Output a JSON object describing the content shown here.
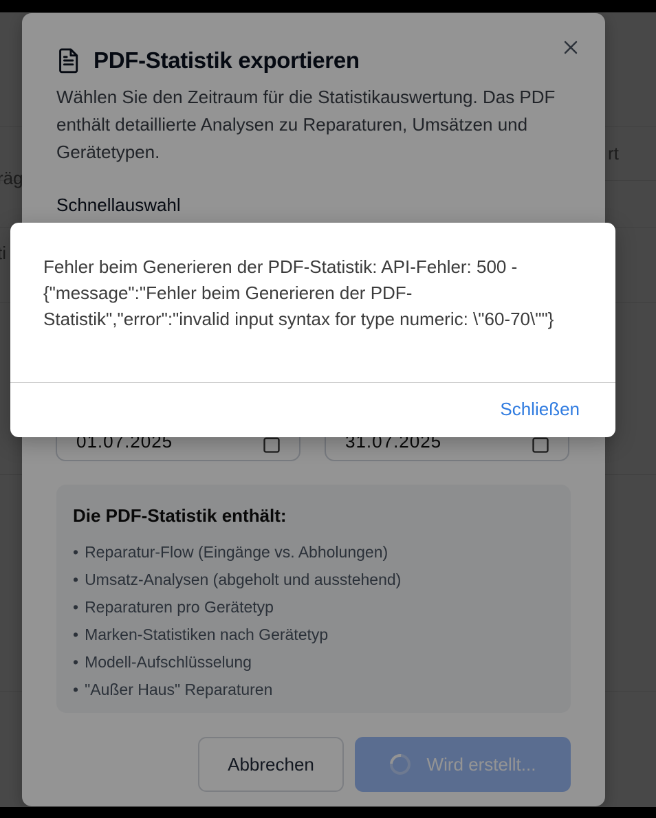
{
  "background": {
    "partial_texts": [
      "rt",
      "räg",
      "ti"
    ]
  },
  "export_dialog": {
    "title": "PDF-Statistik exportieren",
    "description": "Wählen Sie den Zeitraum für die Statistikauswertung. Das PDF enthält detaillierte Analysen zu Reparaturen, Umsätzen und Gerätetypen.",
    "quick_select_label": "Schnellauswahl",
    "start_date": "01.07.2025",
    "end_date": "31.07.2025",
    "info_title": "Die PDF-Statistik enthält:",
    "info_items": [
      "Reparatur-Flow (Eingänge vs. Abholungen)",
      "Umsatz-Analysen (abgeholt und ausstehend)",
      "Reparaturen pro Gerätetyp",
      "Marken-Statistiken nach Gerätetyp",
      "Modell-Aufschlüsselung",
      "\"Außer Haus\" Reparaturen"
    ],
    "cancel_label": "Abbrechen",
    "submit_label": "Wird erstellt..."
  },
  "alert": {
    "message": "Fehler beim Generieren der PDF-Statistik: API-Fehler: 500 - {\"message\":\"Fehler beim Generieren der PDF-Statistik\",\"error\":\"invalid input syntax for type numeric: \\\"60-70\\\"\"}",
    "close_label": "Schließen"
  },
  "colors": {
    "accent": "#2f7be0",
    "primary_button_disabled": "#9bbcf8"
  }
}
